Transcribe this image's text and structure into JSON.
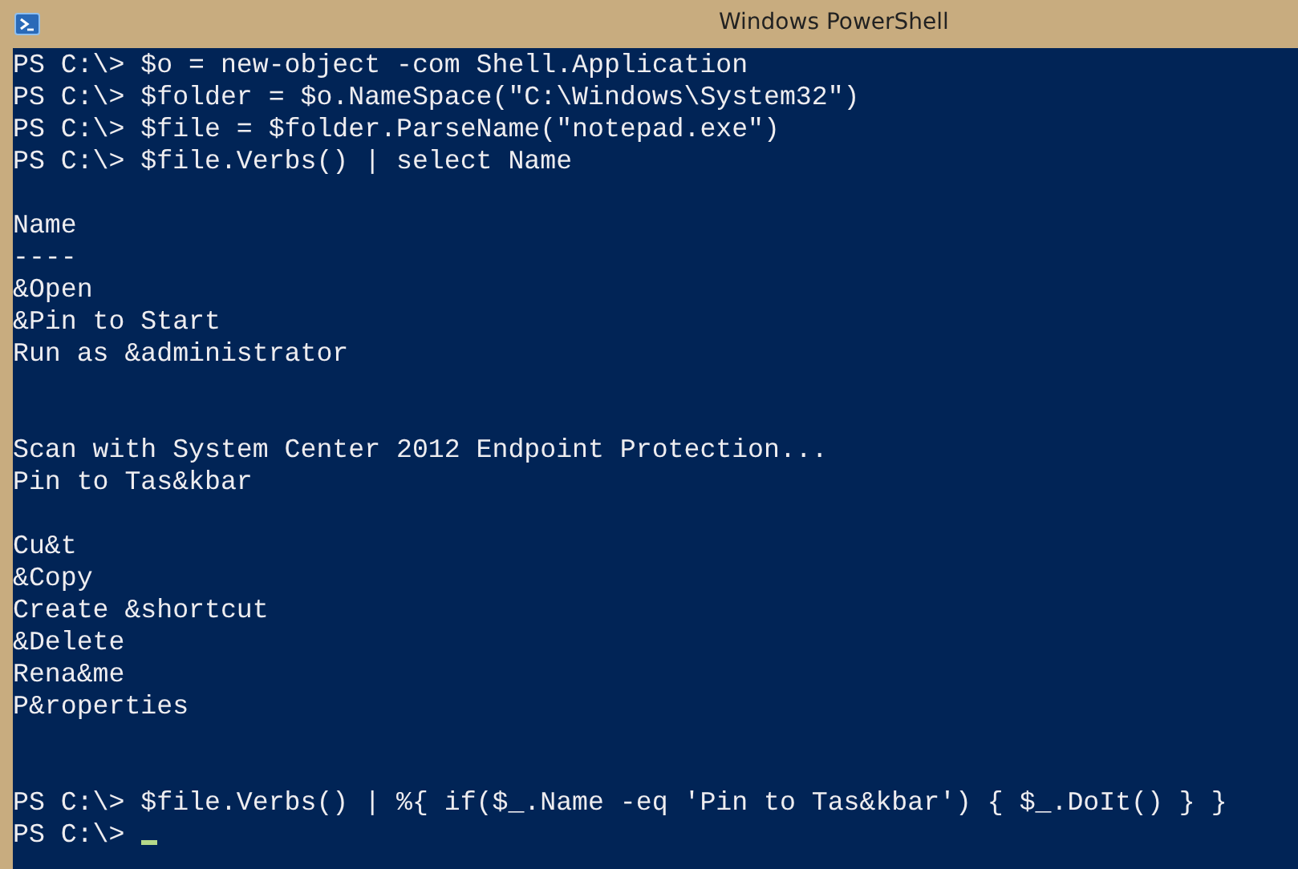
{
  "window": {
    "title": "Windows PowerShell"
  },
  "console": {
    "lines": [
      {
        "kind": "command",
        "prompt": "PS C:\\>",
        "text": "$o = new-object -com Shell.Application"
      },
      {
        "kind": "command",
        "prompt": "PS C:\\>",
        "text": "$folder = $o.NameSpace(\"C:\\Windows\\System32\")"
      },
      {
        "kind": "command",
        "prompt": "PS C:\\>",
        "text": "$file = $folder.ParseName(\"notepad.exe\")"
      },
      {
        "kind": "command",
        "prompt": "PS C:\\>",
        "text": "$file.Verbs() | select Name"
      },
      {
        "kind": "blank"
      },
      {
        "kind": "output",
        "text": "Name"
      },
      {
        "kind": "output",
        "text": "----"
      },
      {
        "kind": "output",
        "text": "&Open"
      },
      {
        "kind": "output",
        "text": "&Pin to Start"
      },
      {
        "kind": "output",
        "text": "Run as &administrator"
      },
      {
        "kind": "blank"
      },
      {
        "kind": "blank"
      },
      {
        "kind": "output",
        "text": "Scan with System Center 2012 Endpoint Protection..."
      },
      {
        "kind": "output",
        "text": "Pin to Tas&kbar"
      },
      {
        "kind": "blank"
      },
      {
        "kind": "output",
        "text": "Cu&t"
      },
      {
        "kind": "output",
        "text": "&Copy"
      },
      {
        "kind": "output",
        "text": "Create &shortcut"
      },
      {
        "kind": "output",
        "text": "&Delete"
      },
      {
        "kind": "output",
        "text": "Rena&me"
      },
      {
        "kind": "output",
        "text": "P&roperties"
      },
      {
        "kind": "blank"
      },
      {
        "kind": "blank"
      },
      {
        "kind": "command",
        "prompt": "PS C:\\>",
        "text": "$file.Verbs() | %{ if($_.Name -eq 'Pin to Tas&kbar') { $_.DoIt() } }"
      },
      {
        "kind": "cursor",
        "prompt": "PS C:\\>"
      }
    ]
  }
}
